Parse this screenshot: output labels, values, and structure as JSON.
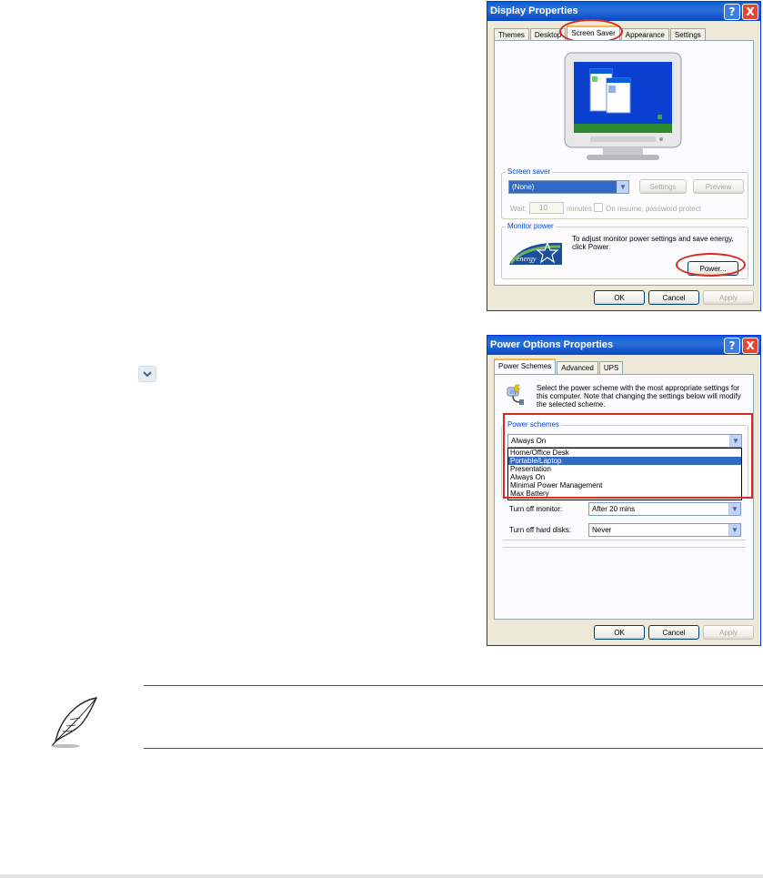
{
  "display_properties": {
    "title": "Display Properties",
    "help_glyph": "?",
    "close_glyph": "X",
    "tabs": [
      "Themes",
      "Desktop",
      "Screen Saver",
      "Appearance",
      "Settings"
    ],
    "screen_saver_group": "Screen saver",
    "screen_saver_value": "(None)",
    "settings_btn": "Settings",
    "preview_btn": "Preview",
    "wait_label": "Wait:",
    "wait_value": "10",
    "minutes_label": "minutes",
    "on_resume_label": "On resume, password protect",
    "monitor_power_group": "Monitor power",
    "monitor_power_text": "To adjust monitor power settings and save energy, click Power.",
    "energy_logo_text": "energy",
    "power_btn": "Power...",
    "ok_btn": "OK",
    "cancel_btn": "Cancel",
    "apply_btn": "Apply"
  },
  "power_options": {
    "title": "Power Options Properties",
    "help_glyph": "?",
    "close_glyph": "X",
    "tabs": [
      "Power Schemes",
      "Advanced",
      "UPS"
    ],
    "description": "Select the power scheme with the most appropriate settings for this computer. Note that changing the settings below will modify the selected scheme.",
    "power_schemes_group": "Power schemes",
    "selected_scheme": "Always On",
    "scheme_options": [
      "Home/Office Desk",
      "Portable/Laptop",
      "Presentation",
      "Always On",
      "Minimal Power Management",
      "Max Battery"
    ],
    "turn_off_monitor_label": "Turn off monitor:",
    "turn_off_monitor_value": "After 20 mins",
    "turn_off_hard_disks_label": "Turn off hard disks:",
    "turn_off_hard_disks_value": "Never",
    "ok_btn": "OK",
    "cancel_btn": "Cancel",
    "apply_btn": "Apply"
  },
  "stray_chevron": "∨",
  "colors": {
    "titlebar": "#0a5fd8",
    "highlight_red": "#d62b1f",
    "selection": "#316ac5",
    "panel": "#fcfcfe",
    "dialog": "#ece9d8"
  },
  "icons": {
    "note": "quill-feather-icon",
    "power_scheme": "power-plug-icon",
    "monitor": "crt-monitor-icon"
  }
}
